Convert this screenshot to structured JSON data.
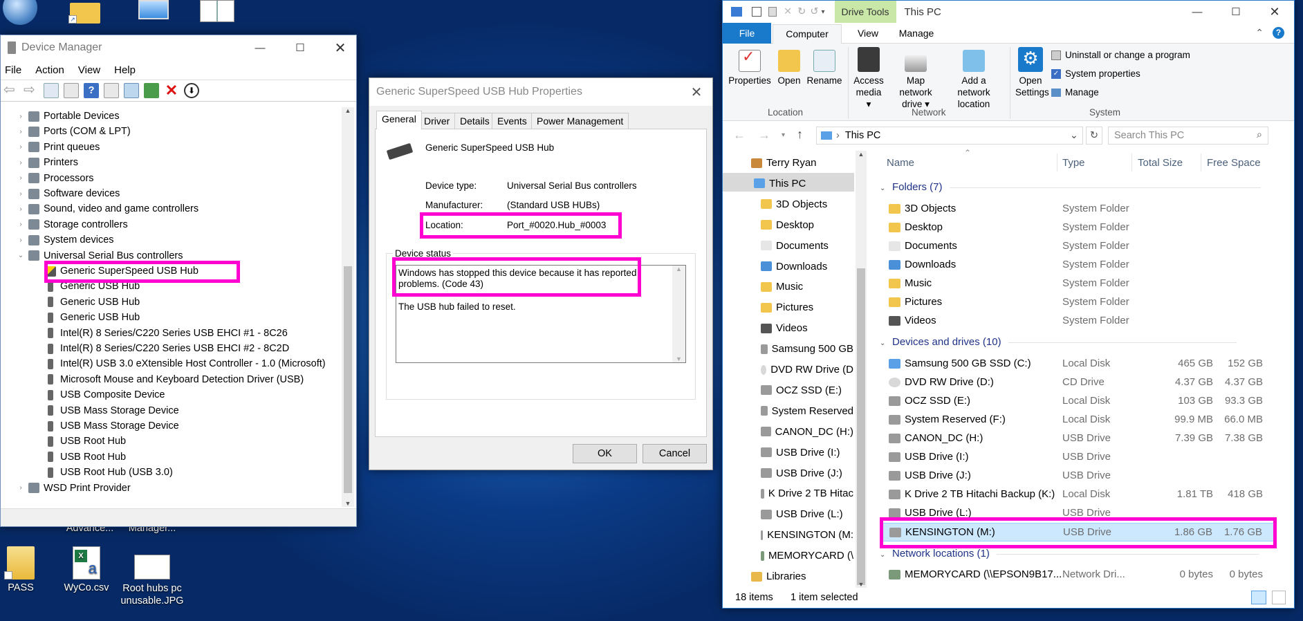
{
  "desktop": {
    "top_icons": [
      {
        "label": ""
      },
      {
        "label": ""
      },
      {
        "label": ""
      },
      {
        "label": ""
      }
    ],
    "bottom_icons": [
      {
        "label": "PASS",
        "icon": "folder-icon"
      },
      {
        "label": "WyCo.csv",
        "icon": "excel-icon"
      },
      {
        "label": "Root hubs pc unusable.JPG",
        "icon": "image-icon"
      }
    ],
    "partial_labels": [
      "Advance...",
      "Manager..."
    ]
  },
  "device_manager": {
    "title": "Device Manager",
    "menu": [
      "File",
      "Action",
      "View",
      "Help"
    ],
    "tree": [
      {
        "label": "Portable Devices",
        "level": 1,
        "expander": "›"
      },
      {
        "label": "Ports (COM & LPT)",
        "level": 1,
        "expander": "›"
      },
      {
        "label": "Print queues",
        "level": 1,
        "expander": "›"
      },
      {
        "label": "Printers",
        "level": 1,
        "expander": "›"
      },
      {
        "label": "Processors",
        "level": 1,
        "expander": "›"
      },
      {
        "label": "Software devices",
        "level": 1,
        "expander": "›"
      },
      {
        "label": "Sound, video and game controllers",
        "level": 1,
        "expander": "›"
      },
      {
        "label": "Storage controllers",
        "level": 1,
        "expander": "›"
      },
      {
        "label": "System devices",
        "level": 1,
        "expander": "›"
      },
      {
        "label": "Universal Serial Bus controllers",
        "level": 1,
        "expander": "⌄"
      },
      {
        "label": "Generic SuperSpeed USB Hub",
        "level": 2,
        "warning": true
      },
      {
        "label": "Generic USB Hub",
        "level": 2
      },
      {
        "label": "Generic USB Hub",
        "level": 2
      },
      {
        "label": "Generic USB Hub",
        "level": 2
      },
      {
        "label": "Intel(R) 8 Series/C220 Series USB EHCI #1 - 8C26",
        "level": 2
      },
      {
        "label": "Intel(R) 8 Series/C220 Series USB EHCI #2 - 8C2D",
        "level": 2
      },
      {
        "label": "Intel(R) USB 3.0 eXtensible Host Controller - 1.0 (Microsoft)",
        "level": 2
      },
      {
        "label": "Microsoft Mouse and Keyboard Detection Driver (USB)",
        "level": 2
      },
      {
        "label": "USB Composite Device",
        "level": 2
      },
      {
        "label": "USB Mass Storage Device",
        "level": 2
      },
      {
        "label": "USB Mass Storage Device",
        "level": 2
      },
      {
        "label": "USB Root Hub",
        "level": 2
      },
      {
        "label": "USB Root Hub",
        "level": 2
      },
      {
        "label": "USB Root Hub (USB 3.0)",
        "level": 2
      },
      {
        "label": "WSD Print Provider",
        "level": 1,
        "expander": "›"
      }
    ]
  },
  "properties_dialog": {
    "title": "Generic SuperSpeed USB Hub Properties",
    "tabs": [
      "General",
      "Driver",
      "Details",
      "Events",
      "Power Management"
    ],
    "device_name": "Generic SuperSpeed USB Hub",
    "fields": [
      {
        "label": "Device type:",
        "value": "Universal Serial Bus controllers"
      },
      {
        "label": "Manufacturer:",
        "value": "(Standard USB HUBs)"
      },
      {
        "label": "Location:",
        "value": "Port_#0020.Hub_#0003"
      }
    ],
    "status_group": "Device status",
    "status_line1": "Windows has stopped this device because it has reported",
    "status_line2": "problems. (Code 43)",
    "status_detail": "The USB hub failed to reset.",
    "ok": "OK",
    "cancel": "Cancel"
  },
  "explorer": {
    "context_tab": "Drive Tools",
    "title": "This PC",
    "ribbon_tabs": [
      "File",
      "Computer",
      "View",
      "Manage"
    ],
    "ribbon": {
      "location": {
        "group": "Location",
        "items": [
          "Properties",
          "Open",
          "Rename"
        ]
      },
      "network": {
        "group": "Network",
        "items": [
          "Access media ▾",
          "Map network drive ▾",
          "Add a network location"
        ]
      },
      "system": {
        "group": "System",
        "open_settings": "Open Settings",
        "items": [
          "Uninstall or change a program",
          "System properties",
          "Manage"
        ]
      }
    },
    "address": "This PC",
    "search_placeholder": "Search This PC",
    "nav": [
      {
        "label": "Terry Ryan",
        "icon": "user-icon"
      },
      {
        "label": "This PC",
        "icon": "pc-icon",
        "selected": true
      },
      {
        "label": "3D Objects",
        "icon": "folder-icon"
      },
      {
        "label": "Desktop",
        "icon": "folder-icon"
      },
      {
        "label": "Documents",
        "icon": "documents-icon"
      },
      {
        "label": "Downloads",
        "icon": "downloads-icon"
      },
      {
        "label": "Music",
        "icon": "music-icon"
      },
      {
        "label": "Pictures",
        "icon": "pictures-icon"
      },
      {
        "label": "Videos",
        "icon": "videos-icon"
      },
      {
        "label": "Samsung 500 GB",
        "icon": "drive-icon"
      },
      {
        "label": "DVD RW Drive (D",
        "icon": "dvd-icon"
      },
      {
        "label": "OCZ SSD (E:)",
        "icon": "drive-icon"
      },
      {
        "label": "System Reserved",
        "icon": "drive-icon"
      },
      {
        "label": "CANON_DC (H:)",
        "icon": "drive-icon"
      },
      {
        "label": "USB Drive (I:)",
        "icon": "drive-icon"
      },
      {
        "label": "USB Drive (J:)",
        "icon": "drive-icon"
      },
      {
        "label": "K Drive 2 TB Hitac",
        "icon": "drive-icon"
      },
      {
        "label": "USB Drive (L:)",
        "icon": "drive-icon"
      },
      {
        "label": "KENSINGTON (M:",
        "icon": "drive-icon"
      },
      {
        "label": "MEMORYCARD (\\",
        "icon": "network-drive-icon"
      },
      {
        "label": "Libraries",
        "icon": "libraries-icon"
      }
    ],
    "columns": [
      "Name",
      "Type",
      "Total Size",
      "Free Space"
    ],
    "folders_group": "Folders (7)",
    "folders": [
      {
        "name": "3D Objects",
        "type": "System Folder"
      },
      {
        "name": "Desktop",
        "type": "System Folder"
      },
      {
        "name": "Documents",
        "type": "System Folder"
      },
      {
        "name": "Downloads",
        "type": "System Folder"
      },
      {
        "name": "Music",
        "type": "System Folder"
      },
      {
        "name": "Pictures",
        "type": "System Folder"
      },
      {
        "name": "Videos",
        "type": "System Folder"
      }
    ],
    "drives_group": "Devices and drives (10)",
    "drives": [
      {
        "name": "Samsung 500 GB SSD (C:)",
        "type": "Local Disk",
        "total": "465 GB",
        "free": "152 GB"
      },
      {
        "name": "DVD RW Drive (D:)",
        "type": "CD Drive",
        "total": "4.37 GB",
        "free": "4.37 GB"
      },
      {
        "name": "OCZ SSD (E:)",
        "type": "Local Disk",
        "total": "103 GB",
        "free": "93.3 GB"
      },
      {
        "name": "System Reserved (F:)",
        "type": "Local Disk",
        "total": "99.9 MB",
        "free": "66.0 MB"
      },
      {
        "name": "CANON_DC (H:)",
        "type": "USB Drive",
        "total": "7.39 GB",
        "free": "7.38 GB"
      },
      {
        "name": "USB Drive (I:)",
        "type": "USB Drive",
        "total": "",
        "free": ""
      },
      {
        "name": "USB Drive (J:)",
        "type": "USB Drive",
        "total": "",
        "free": ""
      },
      {
        "name": "K Drive 2 TB Hitachi Backup (K:)",
        "type": "Local Disk",
        "total": "1.81 TB",
        "free": "418 GB"
      },
      {
        "name": "USB Drive (L:)",
        "type": "USB Drive",
        "total": "",
        "free": ""
      },
      {
        "name": "KENSINGTON (M:)",
        "type": "USB Drive",
        "total": "1.86 GB",
        "free": "1.76 GB",
        "selected": true
      }
    ],
    "network_group": "Network locations (1)",
    "network": [
      {
        "name": "MEMORYCARD (\\\\EPSON9B17...",
        "type": "Network Dri...",
        "total": "0 bytes",
        "free": "0 bytes"
      }
    ],
    "status_items": "18 items",
    "status_selected": "1 item selected"
  },
  "colors": {
    "highlight": "#ff00d0",
    "selection": "#cce8ff",
    "accent": "#1979ca",
    "context_tab": "#c9e7a7"
  }
}
